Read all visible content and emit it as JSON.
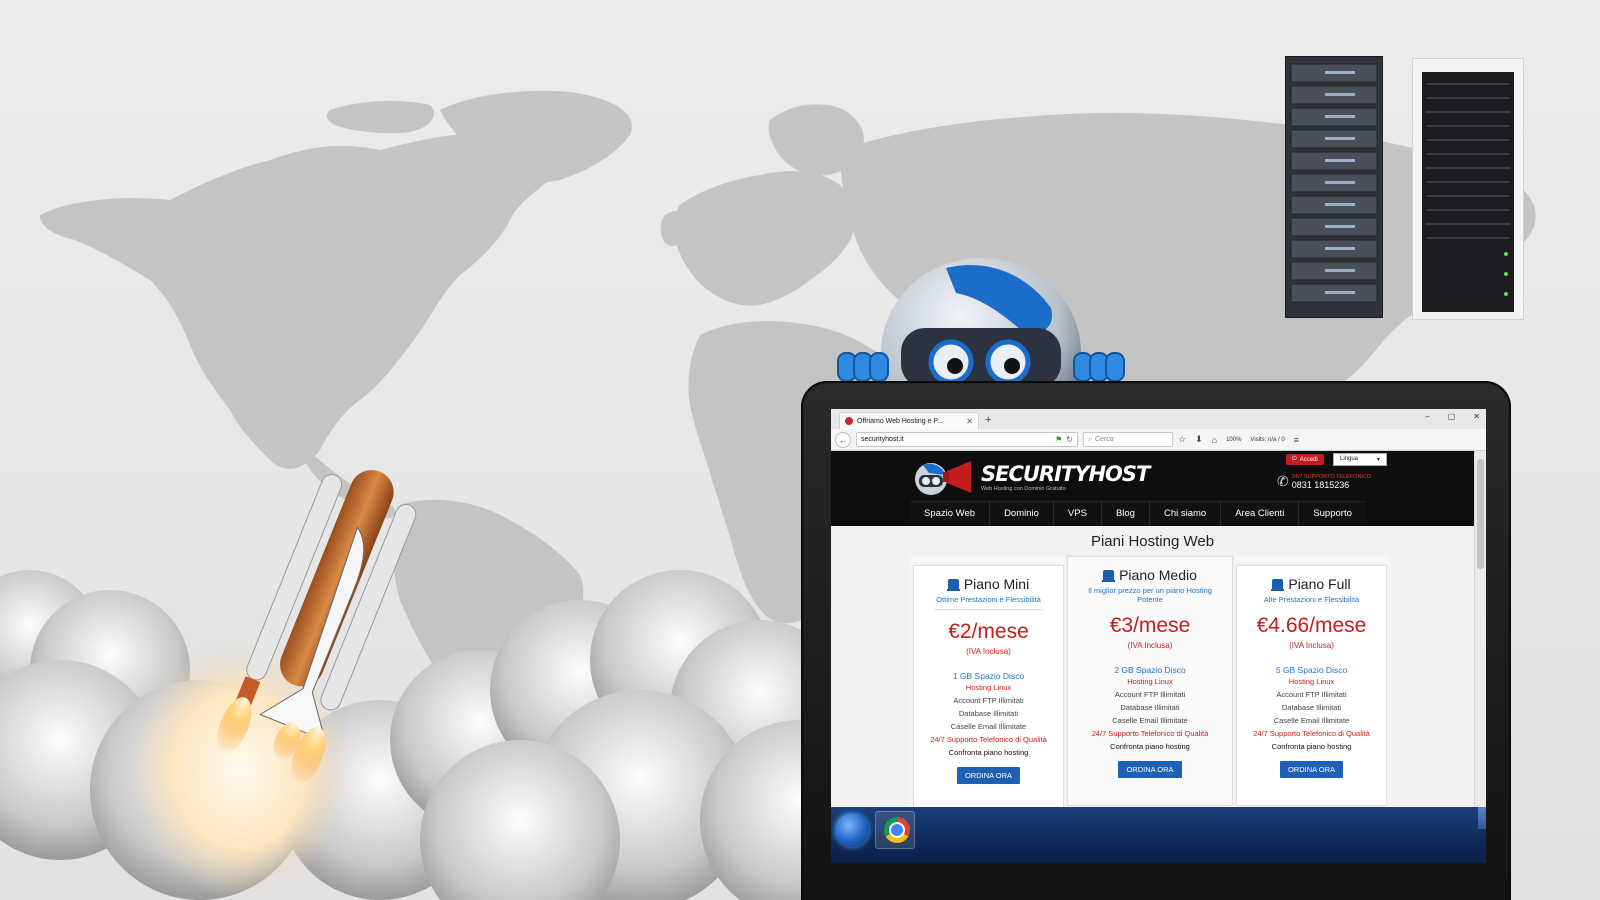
{
  "browser": {
    "tab_title": "Offriamo Web Hosting e P...",
    "new_tab": "+",
    "url": "securityhost.it",
    "search_placeholder": "Cerca",
    "zoom": "100%",
    "visits": "Visits: n/a / 0",
    "window_minimize": "–",
    "window_maximize": "▢",
    "window_close": "✕",
    "tab_close": "✕"
  },
  "site": {
    "logo_security": "SECURITY",
    "logo_host": "HOST",
    "logo_subtitle": "Web Hosting con Dominio Gratuito",
    "login_label": "Accedi",
    "language_label": "Lingua",
    "support_label": "24/7 SUPPORTO TELEFONICO",
    "phone": "0831 1815236",
    "menu": [
      "Spazio Web",
      "Dominio",
      "VPS",
      "Blog",
      "Chi siamo",
      "Area Clienti",
      "Supporto"
    ],
    "page_title": "Piani Hosting Web"
  },
  "plans": [
    {
      "name": "Piano Mini",
      "tagline": "Ottime Prestazioni e Flessibilità",
      "price": "€2/mese",
      "vat": "(IVA Inclusa)",
      "disk": "1 GB Spazio Disco",
      "hosting": "Hosting Linux",
      "ftp": "Account FTP Illimitati",
      "db": "Database Illimitati",
      "email": "Caselle Email Illimitate",
      "support": "24/7 Supporto Telefonico di Qualità",
      "compare": "Confronta piano hosting",
      "order": "ORDINA ORA"
    },
    {
      "name": "Piano Medio",
      "tagline": "Il miglior prezzo per un piano Hosting Potente",
      "price": "€3/mese",
      "vat": "(IVA Inclusa)",
      "disk": "2 GB Spazio Disco",
      "hosting": "Hosting Linux",
      "ftp": "Account FTP Illimitati",
      "db": "Database Illimitati",
      "email": "Caselle Email Illimitate",
      "support": "24/7 Supporto Telefonico di Qualità",
      "compare": "Confronta piano hosting",
      "order": "ORDINA ORA"
    },
    {
      "name": "Piano Full",
      "tagline": "Alte Prestazioni e Flessibilità",
      "price": "€4.66/mese",
      "vat": "(IVA Inclusa)",
      "disk": "5 GB Spazio Disco",
      "hosting": "Hosting Linux",
      "ftp": "Account FTP Illimitati",
      "db": "Database Illimitati",
      "email": "Caselle Email Illimitate",
      "support": "24/7 Supporto Telefonico di Qualità",
      "compare": "Confronta piano hosting",
      "order": "ORDINA ORA"
    }
  ],
  "colors": {
    "brand_red": "#c41d1d",
    "brand_blue": "#1d60b4",
    "link_blue": "#1f76c6",
    "header_black": "#0e0e10",
    "taskbar_blue": "#0f2a58"
  },
  "icons": {
    "back": "←",
    "reload": "↻",
    "search": "⌕",
    "star": "☆",
    "download": "⬇",
    "home": "⌂",
    "menu": "≡",
    "flag": "⚑",
    "phone": "✆"
  }
}
